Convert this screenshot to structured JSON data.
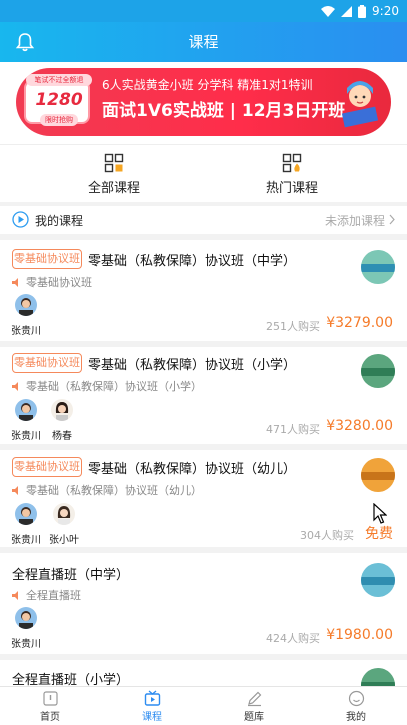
{
  "status_bar": {
    "time": "9:20"
  },
  "header": {
    "title": "课程"
  },
  "banner": {
    "badge_top": "笔试不过全额退",
    "price": "1280",
    "badge_bottom": "限时抢购",
    "subtitle": "6人实战黄金小班 分学科 精准1对1特训",
    "headline": "面试1V6实战班 | 12月3日开班"
  },
  "categories": [
    {
      "label": "全部课程",
      "icon": "all-courses-grid-icon"
    },
    {
      "label": "热门课程",
      "icon": "hot-courses-grid-icon"
    }
  ],
  "my_courses": {
    "label": "我的课程",
    "status": "未添加课程"
  },
  "courses": [
    {
      "tag": "零基础协议班",
      "title": "零基础（私教保障）协议班（中学）",
      "subtitle": "零基础协议班",
      "teachers": [
        "张贵川"
      ],
      "buyers": "251人购买",
      "price": "¥3279.00"
    },
    {
      "tag": "零基础协议班",
      "title": "零基础（私教保障）协议班（小学）",
      "subtitle": "零基础（私教保障）协议班（小学）",
      "teachers": [
        "张贵川",
        "杨春"
      ],
      "buyers": "471人购买",
      "price": "¥3280.00"
    },
    {
      "tag": "零基础协议班",
      "title": "零基础（私教保障）协议班（幼儿）",
      "subtitle": "零基础（私教保障）协议班（幼儿）",
      "teachers": [
        "张贵川",
        "张小叶"
      ],
      "buyers": "304人购买",
      "price": "免费"
    },
    {
      "tag": "",
      "title": "全程直播班（中学）",
      "subtitle": "全程直播班",
      "teachers": [
        "张贵川"
      ],
      "buyers": "424人购买",
      "price": "¥1980.00"
    },
    {
      "tag": "",
      "title": "全程直播班（小学）",
      "subtitle": "",
      "teachers": [],
      "buyers": "",
      "price": ""
    }
  ],
  "bottom_nav": [
    {
      "label": "首页",
      "icon": "home-icon",
      "active": false
    },
    {
      "label": "课程",
      "icon": "course-tv-icon",
      "active": true
    },
    {
      "label": "题库",
      "icon": "question-bank-pencil-icon",
      "active": false
    },
    {
      "label": "我的",
      "icon": "profile-smile-icon",
      "active": false
    }
  ],
  "colors": {
    "header_start": "#18b7ee",
    "header_end": "#2a8ef0",
    "price": "#f57b2a",
    "tag_border": "#f5895b",
    "active_tab": "#2d8cf0"
  }
}
